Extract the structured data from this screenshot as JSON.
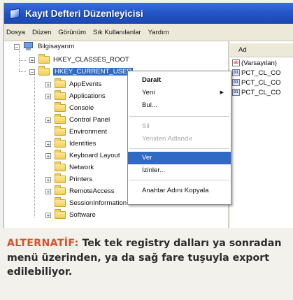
{
  "window": {
    "title": "Kayıt Defteri Düzenleyicisi"
  },
  "menubar": [
    "Dosya",
    "Düzen",
    "Görünüm",
    "Sık Kullanılanlar",
    "Yardım"
  ],
  "tree": {
    "root": "Bilgisayarım",
    "hives": [
      "HKEY_CLASSES_ROOT",
      "HKEY_CURRENT_USER"
    ],
    "children": [
      "AppEvents",
      "Applications",
      "Console",
      "Control Panel",
      "Environment",
      "Identities",
      "Keyboard Layout",
      "Network",
      "Printers",
      "RemoteAccess",
      "SessionInformation",
      "Software"
    ]
  },
  "rightpane": {
    "column_header": "Ad",
    "rows": [
      {
        "icon": "string-value-icon",
        "label": "(Varsayılan)"
      },
      {
        "icon": "binary-value-icon",
        "label": "PCT_CL_CO"
      },
      {
        "icon": "binary-value-icon",
        "label": "PCT_CL_CO"
      },
      {
        "icon": "binary-value-icon",
        "label": "PCT_CL_CO"
      }
    ]
  },
  "context_menu": {
    "items": [
      {
        "label": "Daralt",
        "style": "bold"
      },
      {
        "label": "Yeni",
        "style": "submenu"
      },
      {
        "label": "Bul...",
        "style": "normal"
      },
      {
        "label": "Sil",
        "style": "disabled"
      },
      {
        "label": "Yeniden Adlandır",
        "style": "disabled"
      },
      {
        "label": "Ver",
        "style": "highlighted"
      },
      {
        "label": "İzinler...",
        "style": "normal"
      },
      {
        "label": "Anahtar Adını Kopyala",
        "style": "normal"
      }
    ]
  },
  "caption": {
    "tag": "ALTERNATİF:",
    "text": "Tek tek registry dalları ya sonradan menü üzerinden, ya da sağ fare tuşuyla export edilebiliyor."
  },
  "colors": {
    "accent": "#d5522a",
    "selection": "#316ac5",
    "titlebar": "#2456c8"
  }
}
